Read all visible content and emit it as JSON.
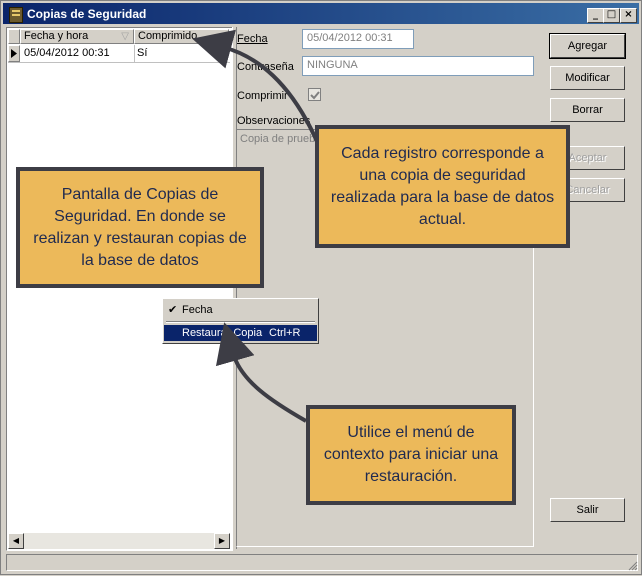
{
  "window": {
    "title": "Copias de Seguridad",
    "controls": {
      "minimize": "_",
      "maximize": "□",
      "close": "×"
    }
  },
  "grid": {
    "columns": [
      "Fecha y hora",
      "Comprimido"
    ],
    "rows": [
      {
        "fecha": "05/04/2012 00:31",
        "comprimido": "Sí"
      }
    ]
  },
  "form": {
    "fecha_label": "Fecha",
    "fecha_value": "05/04/2012 00:31",
    "contrasena_label": "Contraseña",
    "contrasena_value": "NINGUNA",
    "comprimir_label": "Comprimir",
    "comprimir_checked": true,
    "observaciones_label": "Observaciones",
    "observaciones_value": "Copia de prueba"
  },
  "buttons": {
    "agregar": "Agregar",
    "modificar": "Modificar",
    "borrar": "Borrar",
    "aceptar": "Aceptar",
    "cancelar": "Cancelar",
    "salir": "Salir"
  },
  "context_menu": {
    "item1": "Fecha",
    "item2": "Restaurar Copia",
    "item2_shortcut": "Ctrl+R"
  },
  "callouts": {
    "left": "Pantalla de Copias de Seguridad. En donde se realizan y restauran copias de la base de datos",
    "top_right": "Cada registro corresponde a una copia de seguridad realizada para la base de datos actual.",
    "bottom": "Utilice el menú de contexto para iniciar una restauración."
  },
  "colors": {
    "callout_fill": "#ecb95a",
    "callout_border": "#3d3d45",
    "callout_text": "#1f2a50",
    "titlebar": "#0a246a",
    "menu_highlight": "#0a246a"
  }
}
